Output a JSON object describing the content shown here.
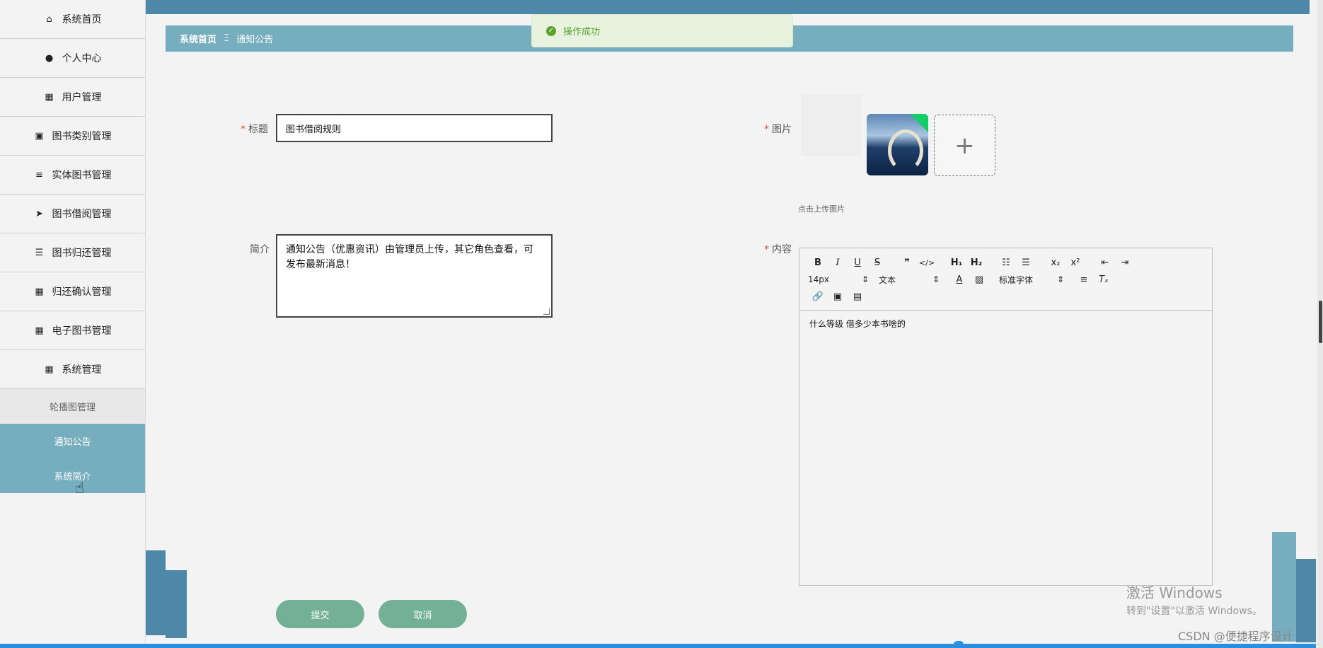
{
  "sidebar": {
    "items": [
      {
        "label": "系统首页",
        "icon": "home-icon",
        "glyph": "⌂"
      },
      {
        "label": "个人中心",
        "icon": "user-icon",
        "glyph": "●"
      },
      {
        "label": "用户管理",
        "icon": "grid-icon",
        "glyph": "▦"
      },
      {
        "label": "图书类别管理",
        "icon": "clipboard-icon",
        "glyph": "▣"
      },
      {
        "label": "实体图书管理",
        "icon": "list-icon",
        "glyph": "≡"
      },
      {
        "label": "图书借阅管理",
        "icon": "send-icon",
        "glyph": "➤"
      },
      {
        "label": "图书归还管理",
        "icon": "sliders-icon",
        "glyph": "☰"
      },
      {
        "label": "归还确认管理",
        "icon": "apps-icon",
        "glyph": "▦"
      },
      {
        "label": "电子图书管理",
        "icon": "grid-icon",
        "glyph": "▦"
      },
      {
        "label": "系统管理",
        "icon": "grid-icon",
        "glyph": "▦"
      }
    ],
    "sub_items": [
      {
        "label": "轮播图管理",
        "active": false
      },
      {
        "label": "通知公告",
        "active": true
      },
      {
        "label": "系统简介",
        "active": true
      }
    ]
  },
  "breadcrumb": {
    "home": "系统首页",
    "separator": "Ξ",
    "current": "通知公告"
  },
  "toast": {
    "message": "操作成功",
    "color": "#5aa12a"
  },
  "form": {
    "title_label": "标题",
    "title_value": "图书借阅规则",
    "intro_label": "简介",
    "intro_value": "通知公告（优惠资讯）由管理员上传，其它角色查看，可发布最新消息！",
    "image_label": "图片",
    "upload_hint": "点击上传图片",
    "upload_plus": "+",
    "content_label": "内容",
    "required_mark": "*",
    "submit_label": "提交",
    "cancel_label": "取消"
  },
  "editor": {
    "font_size": "14px",
    "block_type": "文本",
    "font_family": "标准字体",
    "content": "什么等级 借多少本书啥的"
  },
  "watermark": {
    "line1": "激活 Windows",
    "line2": "转到\"设置\"以激活 Windows。"
  },
  "credit": "CSDN @便捷程序设计",
  "colors": {
    "primary": "#4d88a8",
    "accent": "#76aebf",
    "button": "#74b095",
    "required": "#e0543e"
  }
}
